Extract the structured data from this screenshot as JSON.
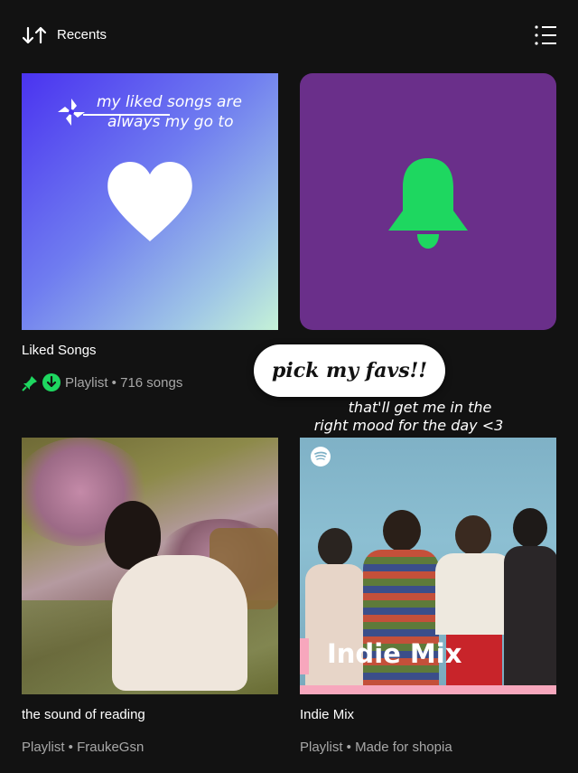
{
  "header": {
    "sort_label": "Recents"
  },
  "liked": {
    "overlay_line1": "my liked songs are",
    "overlay_line2": "always my go to",
    "title": "Liked Songs",
    "meta": "Playlist • 716 songs",
    "gradient_colors": [
      "#4a33f0",
      "#c5f2d7"
    ]
  },
  "bell": {
    "tile_color": "#6a2f8a",
    "icon_color": "#1ed760"
  },
  "sticker": {
    "text": "pick my favs!!"
  },
  "caption": {
    "line1": "that'll get me in the",
    "line2": "right mood for the day <3"
  },
  "reading": {
    "title": "the sound of reading",
    "meta": "Playlist • FraukeGsn"
  },
  "indie": {
    "cover_label": "Indie Mix",
    "title": "Indie Mix",
    "meta": "Playlist • Made for shopia"
  },
  "colors": {
    "accent": "#1ed760",
    "background": "#121212",
    "muted_text": "#a7a7a7"
  }
}
